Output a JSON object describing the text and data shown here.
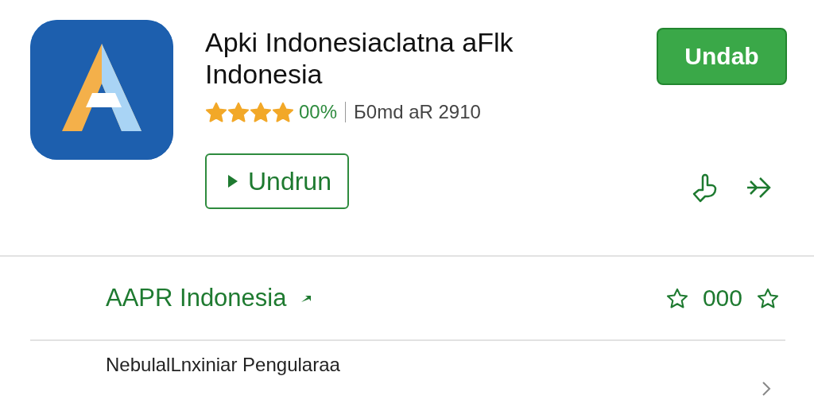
{
  "app": {
    "title": "Apki Indonesiaclatna aFlk Indonesia",
    "stars": 4,
    "rating": "00%",
    "meta": "Б0md aR 2910",
    "install_button": "Undab",
    "open_button": "Undrun"
  },
  "section": {
    "title": "AAPR Indonesia",
    "count": "000",
    "item": "NebulalLnxiniar Pengularaa"
  }
}
